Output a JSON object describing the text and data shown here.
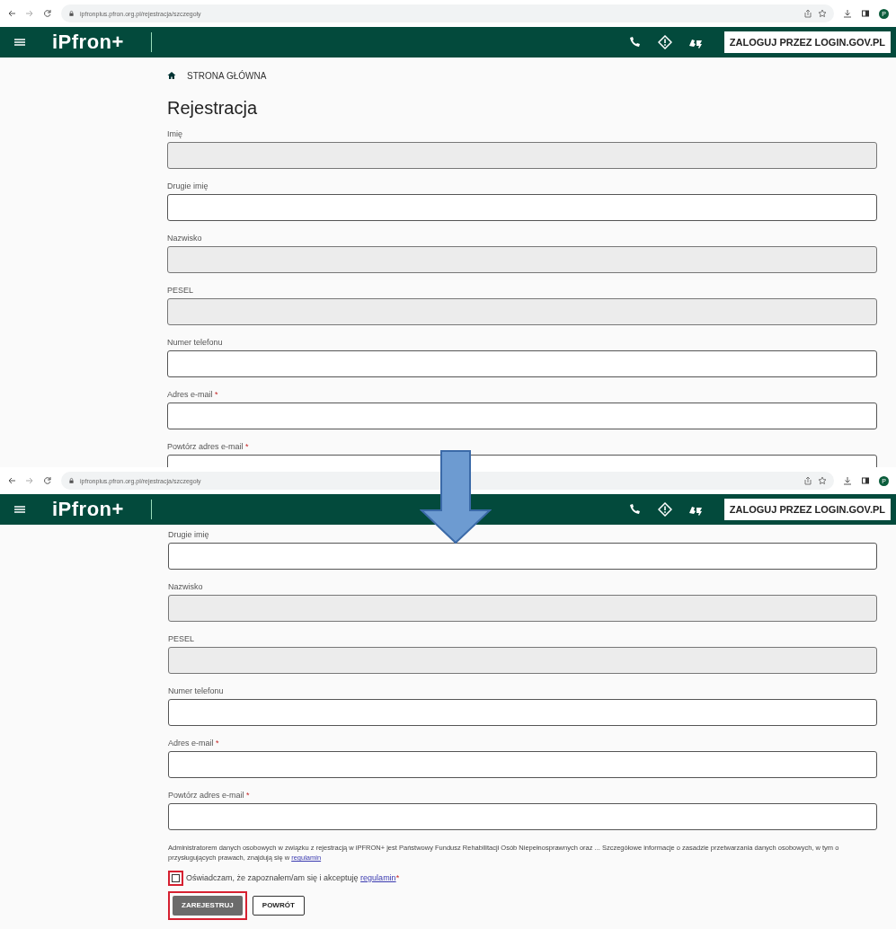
{
  "panels": [
    {
      "browser": {
        "url": "ipfronplus.pfron.org.pl/rejestracja/szczegoly",
        "avatar": "P"
      },
      "header": {
        "logo": "iPfron+",
        "login_button": "ZALOGUJ PRZEZ LOGIN.GOV.PL"
      },
      "breadcrumb": "STRONA GŁÓWNA",
      "title": "Rejestracja",
      "fields": [
        {
          "label": "Imię",
          "disabled": true
        },
        {
          "label": "Drugie imię",
          "disabled": false
        },
        {
          "label": "Nazwisko",
          "disabled": true
        },
        {
          "label": "PESEL",
          "disabled": true
        },
        {
          "label": "Numer telefonu",
          "disabled": false
        },
        {
          "label": "Adres e-mail",
          "required_mark": "*",
          "disabled": false
        },
        {
          "label": "Powtórz adres e-mail",
          "required_mark": "*",
          "disabled": false
        }
      ]
    },
    {
      "browser": {
        "url": "ipfronplus.pfron.org.pl/rejestracja/szczegoly",
        "avatar": "P"
      },
      "header": {
        "logo": "iPfron+",
        "login_button": "ZALOGUJ PRZEZ LOGIN.GOV.PL"
      },
      "fields": [
        {
          "label": "Drugie imię",
          "disabled": false
        },
        {
          "label": "Nazwisko",
          "disabled": true
        },
        {
          "label": "PESEL",
          "disabled": true
        },
        {
          "label": "Numer telefonu",
          "disabled": false
        },
        {
          "label": "Adres e-mail",
          "required_mark": "*",
          "disabled": false
        },
        {
          "label": "Powtórz adres e-mail",
          "required_mark": "*",
          "disabled": false
        }
      ],
      "disclaimer": {
        "text": "Administratorem danych osobowych w związku z rejestracją w iPFRON+ jest Państwowy Fundusz Rehabilitacji Osób Niepełnosprawnych oraz ... Szczegółowe informacje o zasadzie przetwarzania danych osobowych, w tym o przysługujących prawach, znajdują się w",
        "link": "regulamin"
      },
      "consent": {
        "text": "Oświadczam, że zapoznałem/am się i akceptuję",
        "link": "regulamin",
        "required_mark": "*",
        "checked": false,
        "highlighted": true
      },
      "buttons": [
        {
          "label": "ZAREJESTRUJ",
          "kind": "primary",
          "highlighted": true
        },
        {
          "label": "POWRÓT",
          "kind": "secondary",
          "highlighted": false
        }
      ]
    }
  ]
}
